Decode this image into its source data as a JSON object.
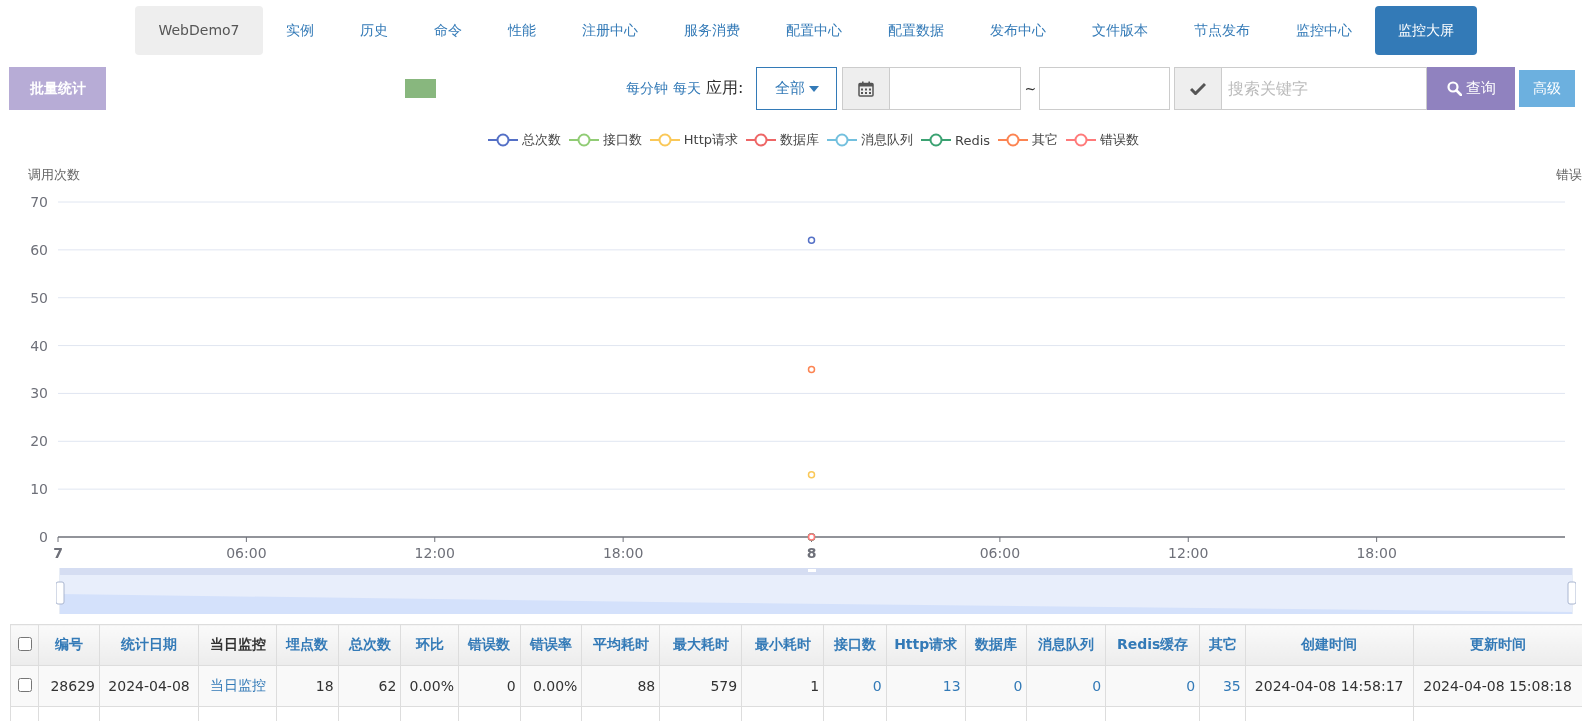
{
  "nav": [
    {
      "label": "WebDemo7",
      "kind": "brand",
      "selected": false
    },
    {
      "label": "实例",
      "kind": "tab",
      "selected": false
    },
    {
      "label": "历史",
      "kind": "tab",
      "selected": false
    },
    {
      "label": "命令",
      "kind": "tab",
      "selected": false
    },
    {
      "label": "性能",
      "kind": "tab",
      "selected": false
    },
    {
      "label": "注册中心",
      "kind": "tab",
      "selected": false
    },
    {
      "label": "服务消费",
      "kind": "tab",
      "selected": false
    },
    {
      "label": "配置中心",
      "kind": "tab",
      "selected": false
    },
    {
      "label": "配置数据",
      "kind": "tab",
      "selected": false
    },
    {
      "label": "发布中心",
      "kind": "tab",
      "selected": false
    },
    {
      "label": "文件版本",
      "kind": "tab",
      "selected": false
    },
    {
      "label": "节点发布",
      "kind": "tab",
      "selected": false
    },
    {
      "label": "监控中心",
      "kind": "tab",
      "selected": false
    },
    {
      "label": "监控大屏",
      "kind": "tab",
      "selected": true
    }
  ],
  "toolbar": {
    "batch_button": "批量统计",
    "period_links": [
      "每分钟",
      "每天"
    ],
    "app_label": "应用:",
    "app_select": "全部",
    "date_separator": "~",
    "search": {
      "placeholder": "搜索关键字"
    },
    "query_button": "查询",
    "advanced_button": "高级"
  },
  "chart": {
    "right_axis_name": "错误",
    "range_slider": {
      "level": 1
    },
    "chart_data": {
      "type": "line",
      "ylabel": "调用次数",
      "grid": true,
      "x": [
        "2024-04-08 00:00"
      ],
      "xlim": [
        "2024-04-07 00:00",
        "2024-04-09 00:00"
      ],
      "ylim": [
        0,
        70
      ],
      "xticks": [
        {
          "value": "2024-04-07 00:00",
          "label": "7"
        },
        {
          "value": "2024-04-07 06:00",
          "label": "06:00"
        },
        {
          "value": "2024-04-07 12:00",
          "label": "12:00"
        },
        {
          "value": "2024-04-07 18:00",
          "label": "18:00"
        },
        {
          "value": "2024-04-08 00:00",
          "label": "8"
        },
        {
          "value": "2024-04-08 06:00",
          "label": "06:00"
        },
        {
          "value": "2024-04-08 12:00",
          "label": "12:00"
        },
        {
          "value": "2024-04-08 18:00",
          "label": "18:00"
        }
      ],
      "yticks": [
        0,
        10,
        20,
        30,
        40,
        50,
        60,
        70
      ],
      "series": [
        {
          "name": "总次数",
          "color": "#5470c6",
          "marker": "circle",
          "values": [
            62
          ]
        },
        {
          "name": "接口数",
          "color": "#91cc75",
          "marker": "circle",
          "values": [
            0
          ]
        },
        {
          "name": "Http请求",
          "color": "#fac858",
          "marker": "circle",
          "values": [
            13
          ]
        },
        {
          "name": "数据库",
          "color": "#ee6666",
          "marker": "circle",
          "values": [
            0
          ]
        },
        {
          "name": "消息队列",
          "color": "#73c0de",
          "marker": "circle",
          "values": [
            0
          ]
        },
        {
          "name": "Redis",
          "color": "#3ba272",
          "marker": "circle",
          "values": [
            0
          ]
        },
        {
          "name": "其它",
          "color": "#fc8452",
          "marker": "circle",
          "values": [
            35
          ]
        },
        {
          "name": "错误数",
          "color": "#ff7a7a",
          "marker": "circle",
          "values": [
            0
          ]
        }
      ]
    }
  },
  "table": {
    "select_all": {
      "checked": false
    },
    "columns": [
      {
        "label": "编号",
        "sortable": true,
        "kind": "number"
      },
      {
        "label": "统计日期",
        "sortable": true,
        "kind": "text"
      },
      {
        "label": "当日监控",
        "sortable": false,
        "kind": "text"
      },
      {
        "label": "埋点数",
        "sortable": true,
        "kind": "number"
      },
      {
        "label": "总次数",
        "sortable": true,
        "kind": "number"
      },
      {
        "label": "环比",
        "sortable": true,
        "kind": "number"
      },
      {
        "label": "错误数",
        "sortable": true,
        "kind": "number"
      },
      {
        "label": "错误率",
        "sortable": true,
        "kind": "number"
      },
      {
        "label": "平均耗时",
        "sortable": true,
        "kind": "number"
      },
      {
        "label": "最大耗时",
        "sortable": true,
        "kind": "number"
      },
      {
        "label": "最小耗时",
        "sortable": true,
        "kind": "number"
      },
      {
        "label": "接口数",
        "sortable": true,
        "kind": "number"
      },
      {
        "label": "Http请求",
        "sortable": true,
        "kind": "number"
      },
      {
        "label": "数据库",
        "sortable": true,
        "kind": "number"
      },
      {
        "label": "消息队列",
        "sortable": true,
        "kind": "number"
      },
      {
        "label": "Redis缓存",
        "sortable": true,
        "kind": "number"
      },
      {
        "label": "其它",
        "sortable": true,
        "kind": "number"
      },
      {
        "label": "创建时间",
        "sortable": true,
        "kind": "text"
      },
      {
        "label": "更新时间",
        "sortable": true,
        "kind": "text"
      }
    ],
    "rows": [
      {
        "checked": false,
        "cells": [
          {
            "text": "28629",
            "link": false
          },
          {
            "text": "2024-04-08",
            "link": false
          },
          {
            "text": "当日监控",
            "link": true
          },
          {
            "text": "18",
            "link": false
          },
          {
            "text": "62",
            "link": false
          },
          {
            "text": "0.00%",
            "link": false
          },
          {
            "text": "0",
            "link": false
          },
          {
            "text": "0.00%",
            "link": false
          },
          {
            "text": "88",
            "link": false
          },
          {
            "text": "579",
            "link": false
          },
          {
            "text": "1",
            "link": false
          },
          {
            "text": "0",
            "link": true
          },
          {
            "text": "13",
            "link": true
          },
          {
            "text": "0",
            "link": true
          },
          {
            "text": "0",
            "link": true
          },
          {
            "text": "0",
            "link": true
          },
          {
            "text": "35",
            "link": true
          },
          {
            "text": "2024-04-08 14:58:17",
            "link": false
          },
          {
            "text": "2024-04-08 15:08:18",
            "link": false
          }
        ]
      }
    ]
  }
}
